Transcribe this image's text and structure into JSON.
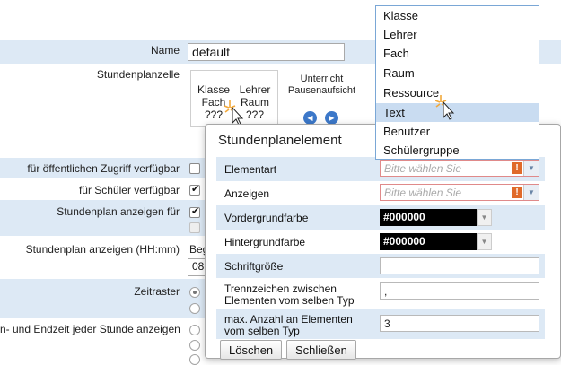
{
  "form": {
    "name_label": "Name",
    "name_value": "default",
    "cell_label": "Stundenplanzelle",
    "cell_preview": {
      "row1": [
        "Klasse",
        "Lehrer"
      ],
      "row2": [
        "Fach",
        "Raum"
      ],
      "row3": [
        "???",
        "???"
      ]
    },
    "unterricht_label": "Unterricht",
    "pausen_label": "Pausenaufsicht",
    "public_access_label": "für öffentlichen Zugriff verfügbar",
    "students_label": "für Schüler verfügbar",
    "show_for_label": "Stundenplan anzeigen für",
    "show_time_label": "Stundenplan anzeigen (HH:mm)",
    "show_time_partial": "Beg",
    "time_value_partial": "08",
    "zeitraster_label": "Zeitraster",
    "start_end_label": "n- und Endzeit jeder Stunde anzeigen"
  },
  "dialog": {
    "title": "Stundenplanelement",
    "fields": [
      {
        "label": "Elementart",
        "placeholder": "Bitte wählen Sie"
      },
      {
        "label": "Anzeigen",
        "placeholder": "Bitte wählen Sie"
      },
      {
        "label": "Vordergrundfarbe",
        "value": "#000000"
      },
      {
        "label": "Hintergrundfarbe",
        "value": "#000000"
      },
      {
        "label": "Schriftgröße",
        "value": ""
      },
      {
        "label_line1": "Trennzeichen zwischen",
        "label_line2": "Elementen vom selben Typ",
        "value": ","
      },
      {
        "label_line1": "max. Anzahl an Elementen",
        "label_line2": "vom selben Typ",
        "value": "3"
      }
    ],
    "delete_label": "Löschen",
    "close_label": "Schließen"
  },
  "dropdown": {
    "items": [
      "Klasse",
      "Lehrer",
      "Fach",
      "Raum",
      "Ressource",
      "Text",
      "Benutzer",
      "Schülergruppe"
    ],
    "highlighted": "Text"
  },
  "colors": {
    "row_blue": "#dde9f5",
    "highlight": "#c9dcf1",
    "error_border": "#e08a8a",
    "warn_icon": "#e06a2a"
  }
}
